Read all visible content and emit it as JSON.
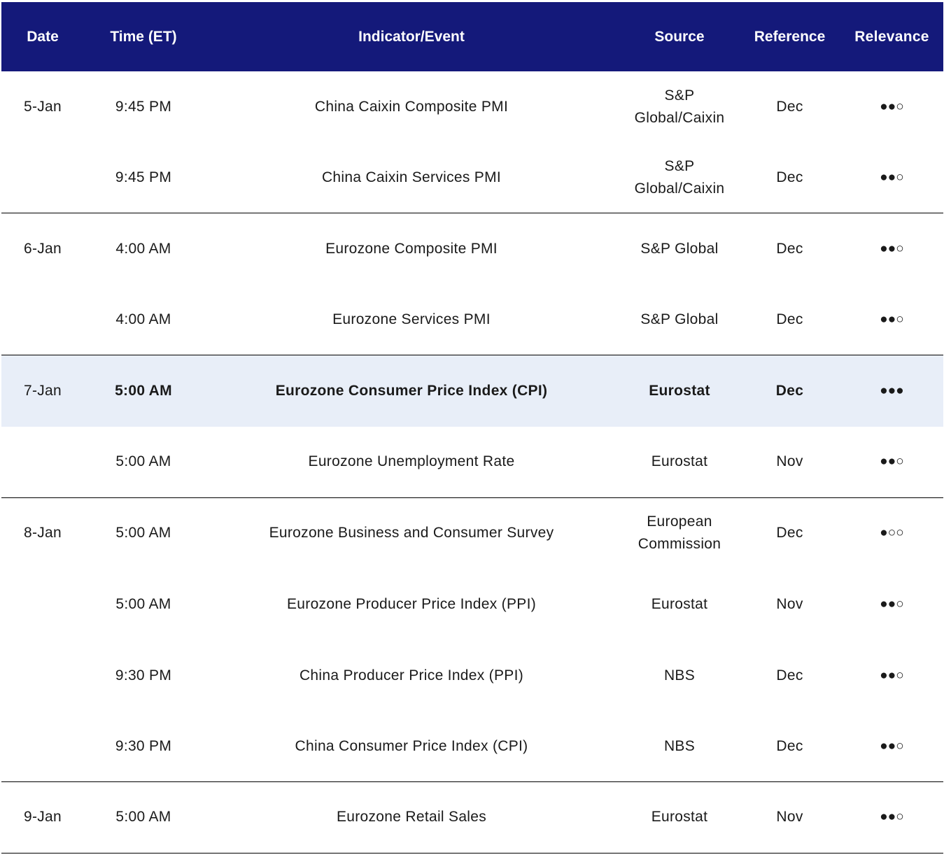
{
  "headers": {
    "date": "Date",
    "time": "Time (ET)",
    "indicator": "Indicator/Event",
    "source": "Source",
    "reference": "Reference",
    "relevance": "Relevance"
  },
  "rows": [
    {
      "date": "5-Jan",
      "time": "9:45 PM",
      "indicator": "China Caixin Composite PMI",
      "source": "S&P Global/Caixin",
      "reference": "Dec",
      "relevance": "●●○"
    },
    {
      "date": "",
      "time": "9:45 PM",
      "indicator": "China Caixin Services PMI",
      "source": "S&P Global/Caixin",
      "reference": "Dec",
      "relevance": "●●○"
    },
    {
      "date": "6-Jan",
      "time": "4:00 AM",
      "indicator": "Eurozone Composite PMI",
      "source": "S&P Global",
      "reference": "Dec",
      "relevance": "●●○"
    },
    {
      "date": "",
      "time": "4:00 AM",
      "indicator": "Eurozone Services PMI",
      "source": "S&P Global",
      "reference": "Dec",
      "relevance": "●●○"
    },
    {
      "date": "7-Jan",
      "time": "5:00 AM",
      "indicator": "Eurozone Consumer Price Index (CPI)",
      "source": "Eurostat",
      "reference": "Dec",
      "relevance": "●●●"
    },
    {
      "date": "",
      "time": "5:00 AM",
      "indicator": "Eurozone Unemployment Rate",
      "source": "Eurostat",
      "reference": "Nov",
      "relevance": "●●○"
    },
    {
      "date": "8-Jan",
      "time": "5:00 AM",
      "indicator": "Eurozone Business and Consumer Survey",
      "source": "European Commission",
      "reference": "Dec",
      "relevance": "●○○"
    },
    {
      "date": "",
      "time": "5:00 AM",
      "indicator": "Eurozone Producer Price Index (PPI)",
      "source": "Eurostat",
      "reference": "Nov",
      "relevance": "●●○"
    },
    {
      "date": "",
      "time": "9:30 PM",
      "indicator": "China Producer Price Index (PPI)",
      "source": "NBS",
      "reference": "Dec",
      "relevance": "●●○"
    },
    {
      "date": "",
      "time": "9:30 PM",
      "indicator": "China Consumer Price Index (CPI)",
      "source": "NBS",
      "reference": "Dec",
      "relevance": "●●○"
    },
    {
      "date": "9-Jan",
      "time": "5:00 AM",
      "indicator": "Eurozone Retail Sales",
      "source": "Eurostat",
      "reference": "Nov",
      "relevance": "●●○"
    }
  ],
  "colors": {
    "header_bg": "#14197a",
    "header_text": "#ffffff",
    "highlight_bg": "#e8eef8",
    "rule": "#000000"
  }
}
